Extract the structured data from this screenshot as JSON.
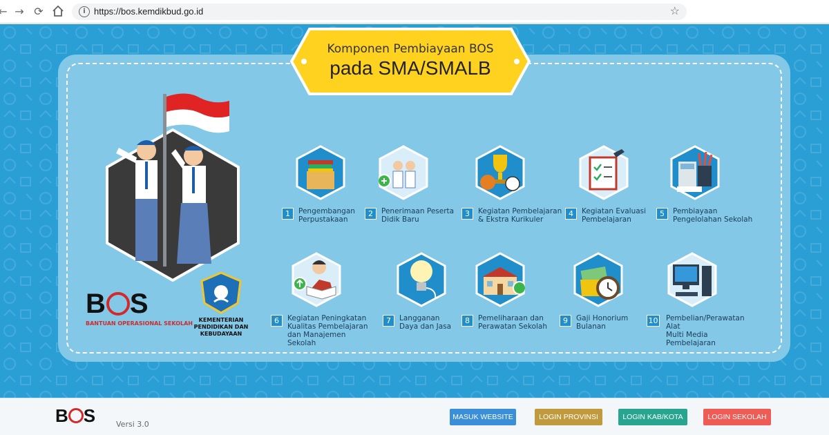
{
  "browser": {
    "url": "https://bos.kemdikbud.go.id",
    "back_icon": "arrow-left-icon",
    "forward_icon": "arrow-right-icon",
    "reload_icon": "reload-icon",
    "home_icon": "home-icon",
    "info_icon": "info-icon",
    "star_icon": "star-icon"
  },
  "title": {
    "line1": "Komponen Pembiayaan BOS",
    "line2": "pada SMA/SMALB"
  },
  "logos": {
    "bos_text_b": "B",
    "bos_text_s": "S",
    "bos_subtitle": "BANTUAN OPERASIONAL SEKOLAH",
    "kemdik_line1": "KEMENTERIAN",
    "kemdik_line2": "PENDIDIKAN DAN KEBUDAYAAN"
  },
  "items": [
    {
      "num": "1",
      "label1": "Pengembangan",
      "label2": "Perpustakaan",
      "label3": "",
      "icon": "books-box-icon"
    },
    {
      "num": "2",
      "label1": "Penerimaan Peserta",
      "label2": "Didik Baru",
      "label3": "",
      "icon": "new-students-icon"
    },
    {
      "num": "3",
      "label1": "Kegiatan Pembelajaran",
      "label2": "& Ekstra Kurikuler",
      "label3": "",
      "icon": "trophy-balls-icon"
    },
    {
      "num": "4",
      "label1": "Kegiatan Evaluasi",
      "label2": "Pembelajaran",
      "label3": "",
      "icon": "checklist-icon"
    },
    {
      "num": "5",
      "label1": "Pembiayaan",
      "label2": "Pengelolahan Sekolah",
      "label3": "",
      "icon": "calculator-stationery-icon"
    },
    {
      "num": "6",
      "label1": "Kegiatan Peningkatan",
      "label2": "Kualitas Pembelajaran",
      "label3": "dan Manajemen Sekolah",
      "icon": "teacher-reading-icon"
    },
    {
      "num": "7",
      "label1": "Langganan",
      "label2": "Daya dan Jasa",
      "label3": "",
      "icon": "light-bulb-icon"
    },
    {
      "num": "8",
      "label1": "Pemeliharaan dan",
      "label2": "Perawatan Sekolah",
      "label3": "",
      "icon": "school-building-icon"
    },
    {
      "num": "9",
      "label1": "Gaji Honorium",
      "label2": "Bulanan",
      "label3": "",
      "icon": "money-clock-icon"
    },
    {
      "num": "10",
      "label1": "Pembelian/Perawatan Alat",
      "label2": "Multi Media Pembelajaran",
      "label3": "",
      "icon": "computer-icon"
    }
  ],
  "footer": {
    "logo_b": "B",
    "logo_s": "S",
    "version": "Versi 3.0",
    "buttons": [
      {
        "label": "MASUK WEBSITE",
        "color": "#3a8fd8"
      },
      {
        "label": "LOGIN PROVINSI",
        "color": "#c29a3e"
      },
      {
        "label": "LOGIN KAB/KOTA",
        "color": "#27a58f"
      },
      {
        "label": "LOGIN SEKOLAH",
        "color": "#ef5b55"
      }
    ]
  },
  "colors": {
    "background_blue": "#2a9fd6",
    "panel_blue": "#83c8e6",
    "ribbon_yellow": "#ffd21f",
    "hex_blue": "#1f8ecb"
  }
}
